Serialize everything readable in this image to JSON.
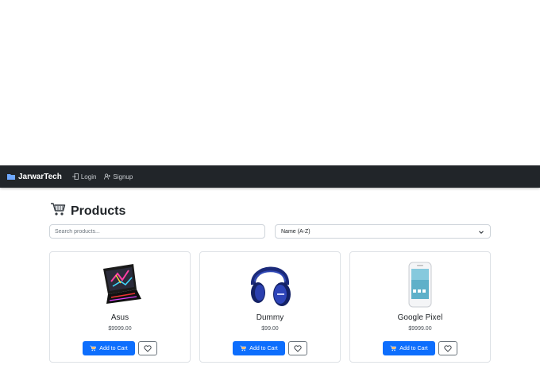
{
  "navbar": {
    "brand": "JarwarTech",
    "links": [
      {
        "label": "Login",
        "icon": "login-icon"
      },
      {
        "label": "Signup",
        "icon": "user-plus-icon"
      }
    ],
    "background": "#212529"
  },
  "page": {
    "title": "Products",
    "title_icon": "shopping-cart-icon"
  },
  "filters": {
    "search_placeholder": "Search products...",
    "search_value": "",
    "sort_selected": "Name (A-Z)"
  },
  "products": [
    {
      "name": "Asus",
      "price": "$9999.00",
      "image": "laptop-image",
      "add_label": "Add to Cart"
    },
    {
      "name": "Dummy",
      "price": "$99.00",
      "image": "headphones-image",
      "add_label": "Add to Cart"
    },
    {
      "name": "Google Pixel",
      "price": "$9999.00",
      "image": "phone-image",
      "add_label": "Add to Cart"
    }
  ],
  "colors": {
    "accent": "#0d6efd",
    "navbar": "#212529",
    "border": "#dee2e6"
  }
}
